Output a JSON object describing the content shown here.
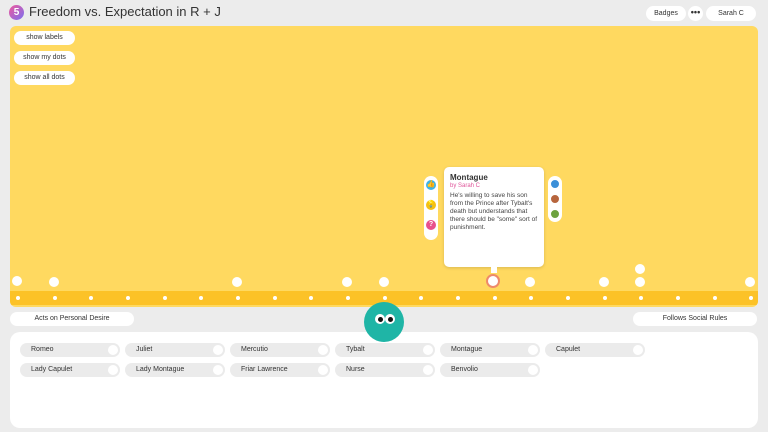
{
  "header": {
    "logo_glyph": "5",
    "title": "Freedom vs. Expectation in R + J",
    "badges_label": "Badges",
    "more_glyph": "•••",
    "user_label": "Sarah C"
  },
  "controls": {
    "show_labels": "show labels",
    "show_my_dots": "show my dots",
    "show_all_dots": "show all dots"
  },
  "popup": {
    "title": "Montague",
    "author": "by Sarah C",
    "text": "He's willing to save his son from the Prince after Tybalt's death but understands that there should be \"some\" sort of punishment.",
    "actions": [
      {
        "icon": "thumbs-up-icon",
        "glyph": "👍",
        "color": "#3fb4e6"
      },
      {
        "icon": "lightbulb-icon",
        "glyph": "💡",
        "color": "#f3c013"
      },
      {
        "icon": "question-icon",
        "glyph": "?",
        "color": "#e8508c"
      }
    ],
    "avatars": [
      {
        "icon": "avatar-blue-icon",
        "color": "#3b8fd8"
      },
      {
        "icon": "avatar-brown-icon",
        "color": "#b7653d"
      },
      {
        "icon": "avatar-green-icon",
        "color": "#6da23f"
      }
    ]
  },
  "axis": {
    "left_label": "Acts on Personal Desire",
    "right_label": "Follows Social Rules"
  },
  "characters": [
    {
      "label": "Romeo"
    },
    {
      "label": "Juliet"
    },
    {
      "label": "Mercutio"
    },
    {
      "label": "Tybalt"
    },
    {
      "label": "Montague"
    },
    {
      "label": "Capulet"
    },
    {
      "label": "Lady Capulet"
    },
    {
      "label": "Lady Montague"
    },
    {
      "label": "Friar Lawrence"
    },
    {
      "label": "Nurse"
    },
    {
      "label": "Benvolio"
    }
  ],
  "colors": {
    "canvas": "#ffd960",
    "track": "#fcc227",
    "mascot": "#1fb5a6",
    "author_accent": "#e0559a"
  }
}
